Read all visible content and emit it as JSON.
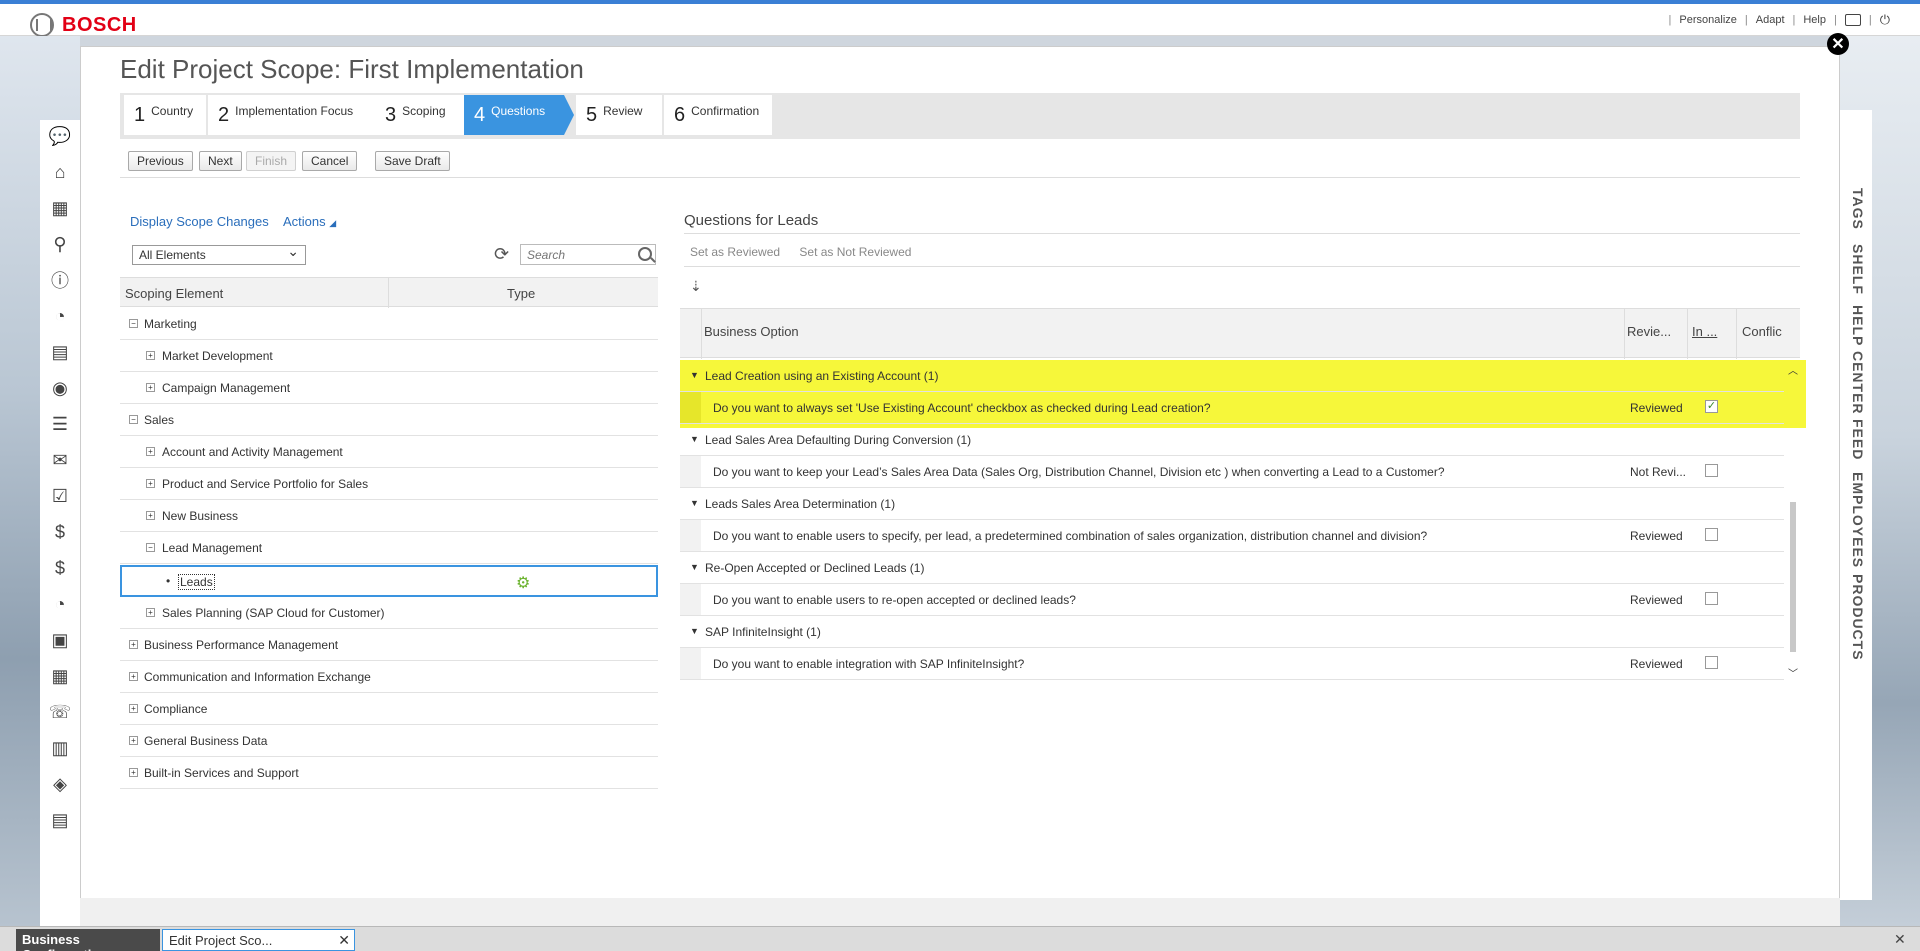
{
  "topbar": {
    "logo": "BOSCH",
    "links": [
      "Personalize",
      "Adapt",
      "Help"
    ]
  },
  "dialog": {
    "title": "Edit Project Scope: First Implementation"
  },
  "wizard": {
    "steps": [
      {
        "num": "1",
        "label": "Country"
      },
      {
        "num": "2",
        "label": "Implementation Focus"
      },
      {
        "num": "3",
        "label": "Scoping"
      },
      {
        "num": "4",
        "label": "Questions"
      },
      {
        "num": "5",
        "label": "Review"
      },
      {
        "num": "6",
        "label": "Confirmation"
      }
    ],
    "active_step": "4"
  },
  "buttons": {
    "previous": "Previous",
    "next": "Next",
    "finish": "Finish",
    "cancel": "Cancel",
    "save_draft": "Save Draft"
  },
  "left_panel": {
    "display_scope_changes": "Display Scope Changes",
    "actions": "Actions",
    "filter_selected": "All Elements",
    "search_placeholder": "Search",
    "columns": [
      "Scoping Element",
      "Type"
    ],
    "rows": [
      {
        "label": "Marketing",
        "expander": "−"
      },
      {
        "label": "Market Development",
        "expander": "+"
      },
      {
        "label": "Campaign Management",
        "expander": "+"
      },
      {
        "label": "Sales",
        "expander": "−"
      },
      {
        "label": "Account and Activity Management",
        "expander": "+"
      },
      {
        "label": "Product and Service Portfolio for Sales",
        "expander": "+"
      },
      {
        "label": "New Business",
        "expander": "+"
      },
      {
        "label": "Lead Management",
        "expander": "−"
      },
      {
        "label": "Leads",
        "expander": ""
      },
      {
        "label": "Sales Planning (SAP Cloud for Customer)",
        "expander": "+"
      },
      {
        "label": "Business Performance Management",
        "expander": "+"
      },
      {
        "label": "Communication and Information Exchange",
        "expander": "+"
      },
      {
        "label": "Compliance",
        "expander": "+"
      },
      {
        "label": "General Business Data",
        "expander": "+"
      },
      {
        "label": "Built-in Services and Support",
        "expander": "+"
      }
    ]
  },
  "right_panel": {
    "title": "Questions for Leads",
    "set_reviewed": "Set as Reviewed",
    "set_not_reviewed": "Set as Not Reviewed",
    "columns": [
      "Business Option",
      "Revie...",
      "In ...",
      "Conflic"
    ],
    "groups": [
      {
        "title": "Lead Creation using an Existing Account (1)",
        "question": "Do you want to always set 'Use Existing Account' checkbox as checked during Lead creation?",
        "review": "Reviewed",
        "checked": "✓"
      },
      {
        "title": "Lead Sales Area Defaulting During Conversion (1)",
        "question": "Do you want to keep your Lead’s Sales Area Data (Sales Org, Distribution Channel, Division etc ) when converting a Lead to a Customer?",
        "review": "Not Revi...",
        "checked": ""
      },
      {
        "title": "Leads Sales Area Determination (1)",
        "question": "Do you want to enable users to specify, per lead, a predetermined combination of sales organization, distribution channel and division?",
        "review": "Reviewed",
        "checked": ""
      },
      {
        "title": "Re-Open Accepted or Declined Leads (1)",
        "question": "Do you want to enable users to re-open accepted or declined leads?",
        "review": "Reviewed",
        "checked": ""
      },
      {
        "title": "SAP InfiniteInsight (1)",
        "question": "Do you want to enable integration with SAP InfiniteInsight?",
        "review": "Reviewed",
        "checked": ""
      }
    ]
  },
  "side_tabs": [
    "TAGS",
    "SHELF",
    "HELP CENTER",
    "FEED",
    "EMPLOYEES",
    "PRODUCTS"
  ],
  "taskbar": {
    "tab1": "Business Configuration",
    "tab2": "Edit Project Sco..."
  },
  "colors": {
    "accent": "#3a94e0",
    "highlight": "#f6f73a",
    "brand": "#e20015"
  }
}
